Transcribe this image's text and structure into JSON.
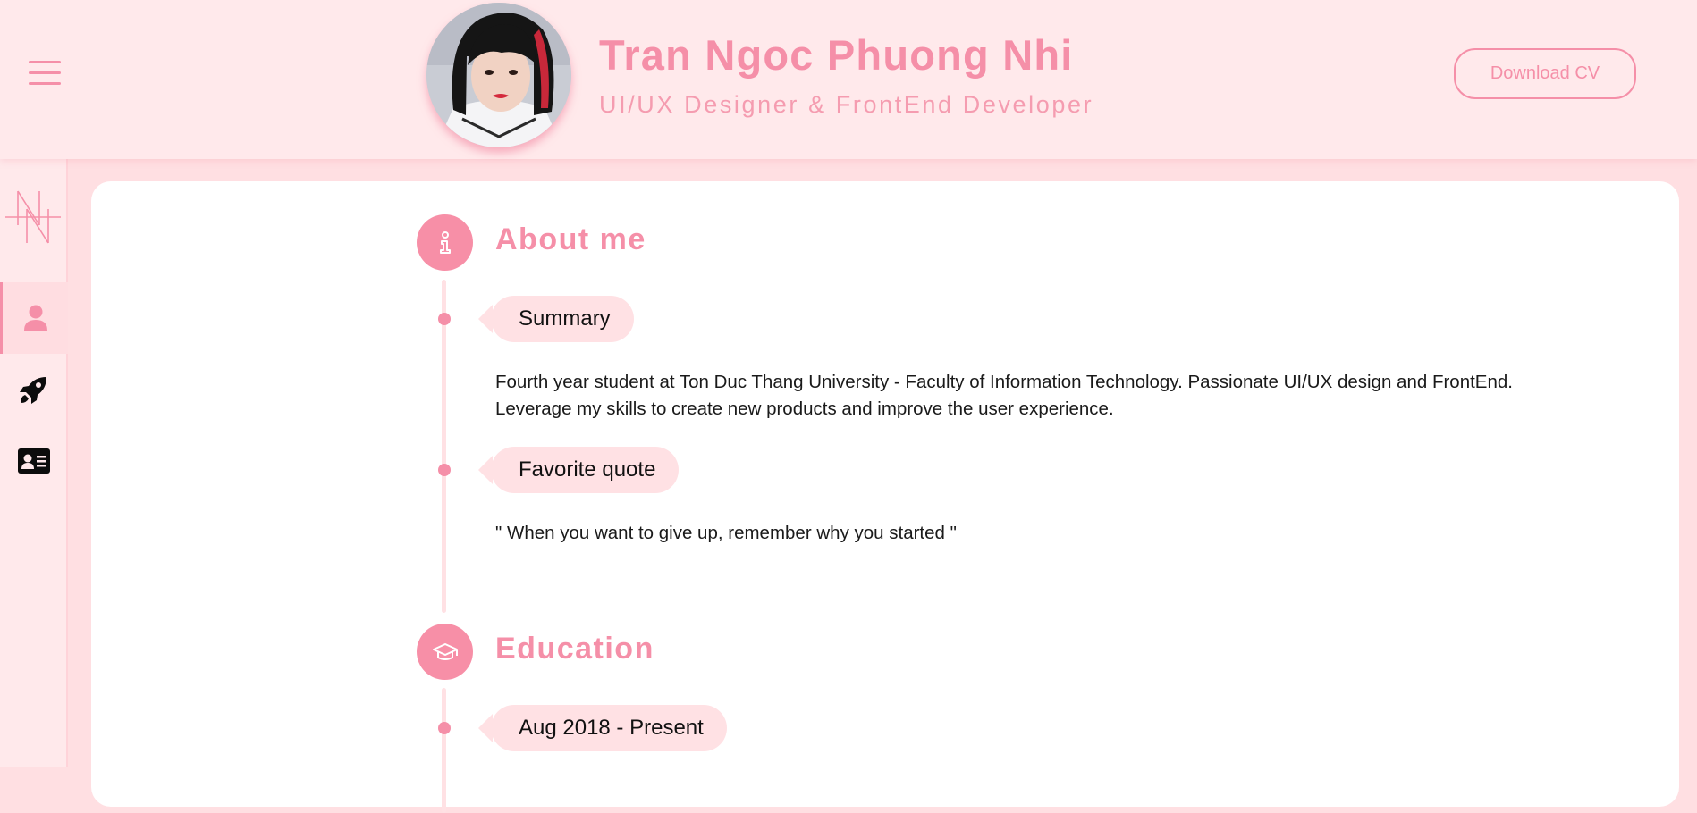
{
  "header": {
    "name": "Tran Ngoc Phuong Nhi",
    "role": "UI/UX Designer & FrontEnd Developer",
    "download_label": "Download CV"
  },
  "sidebar": {
    "items": [
      {
        "icon": "user-icon",
        "active": true
      },
      {
        "icon": "rocket-icon",
        "active": false
      },
      {
        "icon": "id-card-icon",
        "active": false
      }
    ]
  },
  "sections": {
    "about": {
      "title": "About me",
      "summary_label": "Summary",
      "summary_text": "Fourth year student at Ton Duc Thang University - Faculty of Information Technology. Passionate UI/UX design and FrontEnd. Leverage my skills to create new products and improve the user experience.",
      "quote_label": "Favorite quote",
      "quote_text": "\" When you want to give up, remember why you started \""
    },
    "education": {
      "title": "Education",
      "period_label": "Aug 2018 - Present"
    }
  },
  "colors": {
    "accent": "#f58fa8",
    "header_bg": "#ffe9eb",
    "page_bg": "#ffdfe2",
    "tag_bg": "#ffe1e4",
    "card_bg": "#ffffff"
  }
}
